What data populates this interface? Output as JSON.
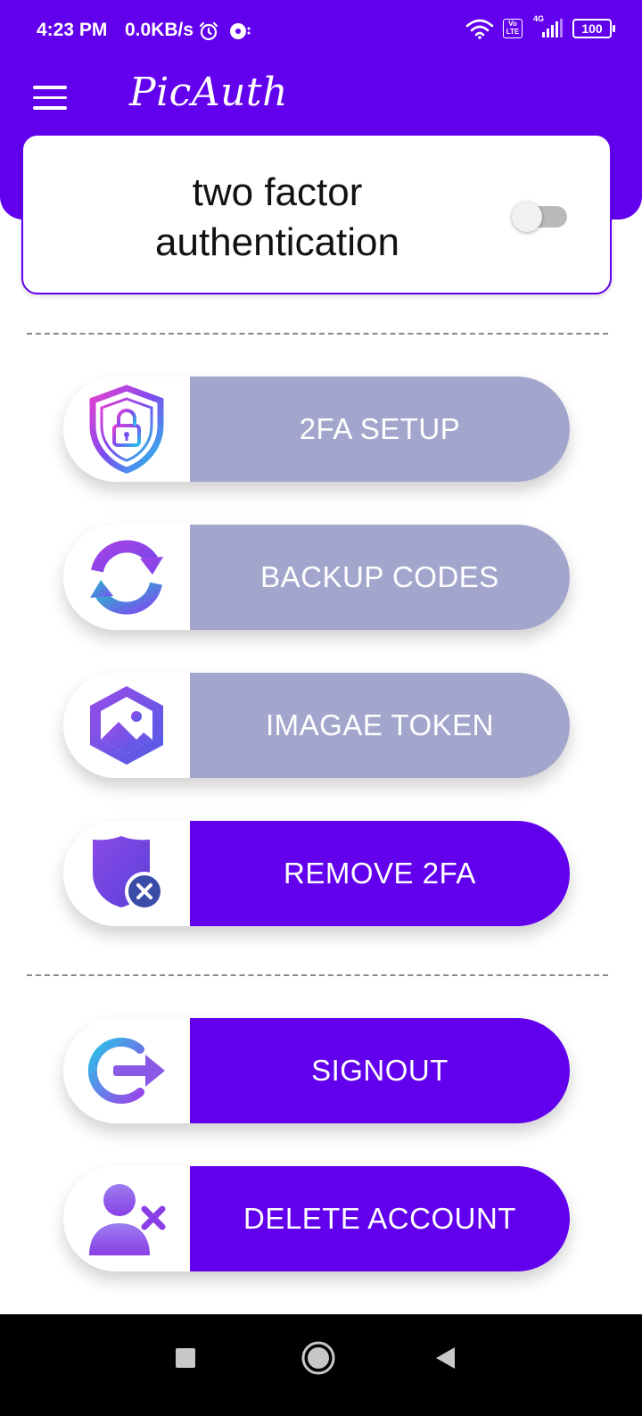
{
  "status_bar": {
    "time": "4:23 PM",
    "net_speed": "0.0KB/s",
    "network": "4G",
    "lte_badge": "Vo LTE",
    "battery": "100"
  },
  "app_bar": {
    "title": "PicAuth",
    "menu_icon": "hamburger-menu-icon"
  },
  "two_factor": {
    "label": "two factor authentication",
    "enabled": false
  },
  "actions": [
    {
      "label": "2FA SETUP",
      "icon": "shield-lock-icon",
      "state": "disabled"
    },
    {
      "label": "BACKUP CODES",
      "icon": "refresh-icon",
      "state": "disabled"
    },
    {
      "label": "IMAGAE TOKEN",
      "icon": "image-token-icon",
      "state": "disabled"
    },
    {
      "label": "REMOVE 2FA",
      "icon": "shield-remove-icon",
      "state": "enabled"
    }
  ],
  "account_actions": [
    {
      "label": "SIGNOUT",
      "icon": "signout-icon"
    },
    {
      "label": "DELETE ACCOUNT",
      "icon": "delete-user-icon"
    }
  ],
  "colors": {
    "primary": "#6200ee",
    "disabled_button": "#a3a6cc",
    "background": "#ffffff",
    "nav_bar": "#000000"
  }
}
